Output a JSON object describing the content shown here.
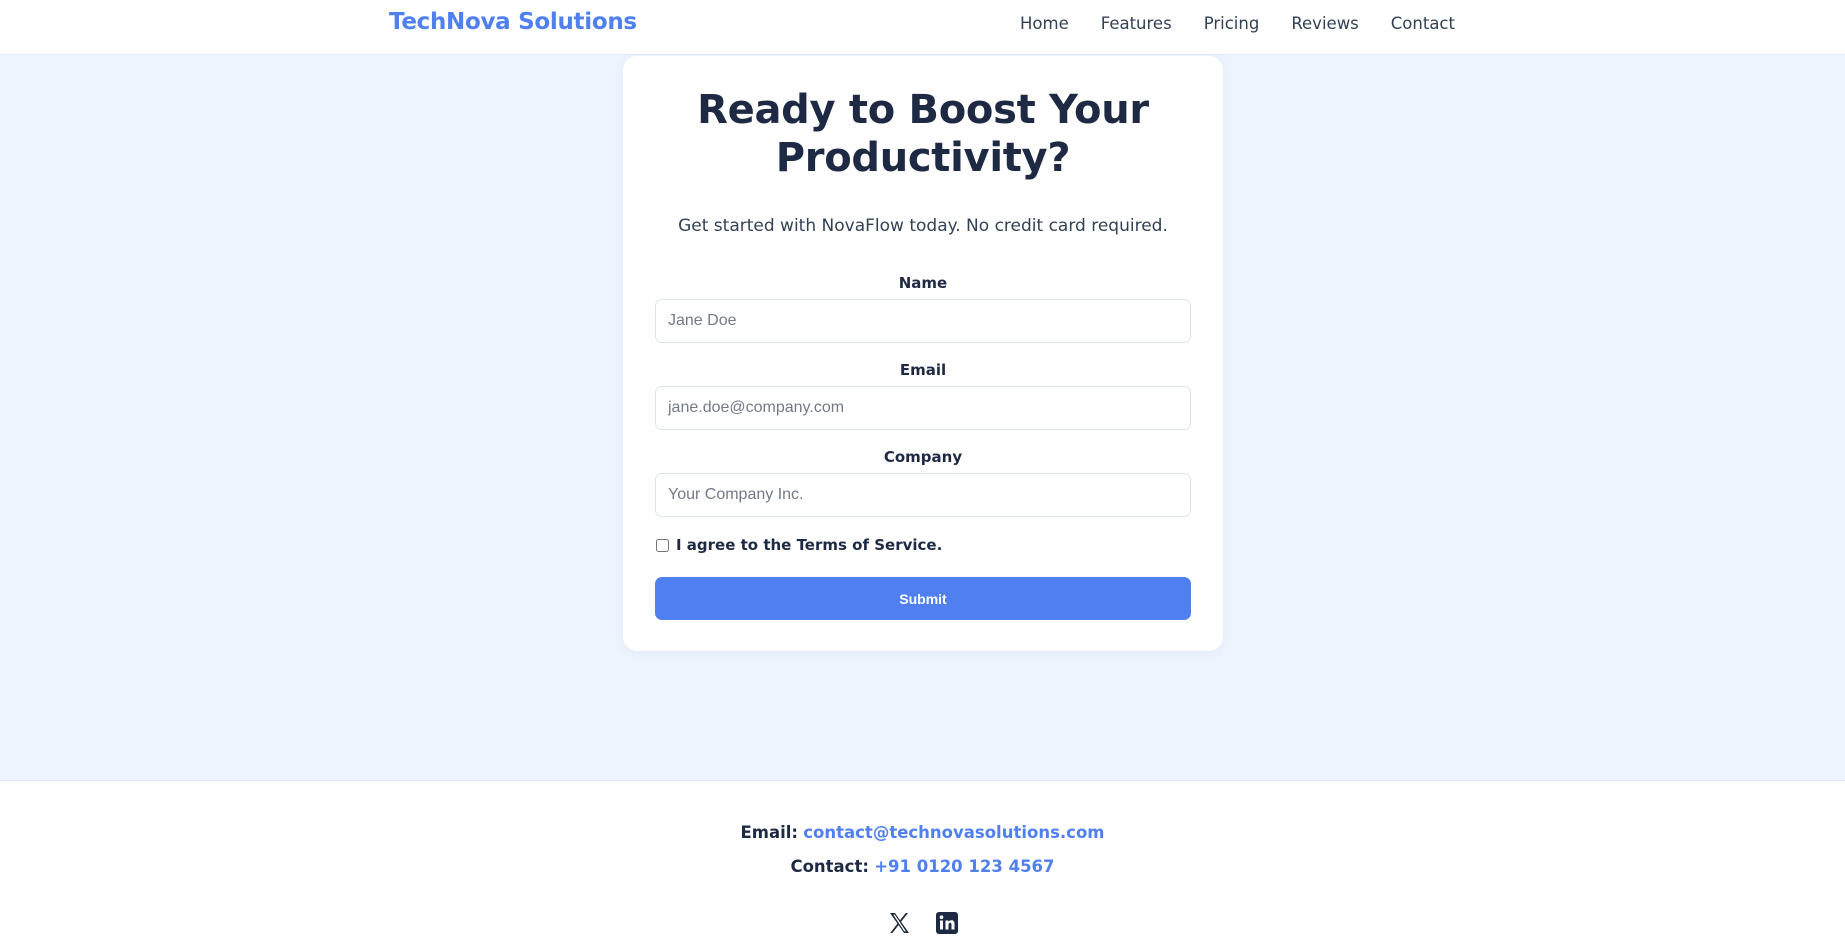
{
  "header": {
    "brand": "TechNova Solutions",
    "nav": [
      "Home",
      "Features",
      "Pricing",
      "Reviews",
      "Contact"
    ]
  },
  "signup": {
    "title": "Ready to Boost Your Productivity?",
    "subtitle": "Get started with NovaFlow today. No credit card required.",
    "name_label": "Name",
    "name_placeholder": "Jane Doe",
    "name_value": "",
    "email_label": "Email",
    "email_placeholder": "jane.doe@company.com",
    "email_value": "",
    "company_label": "Company",
    "company_placeholder": "Your Company Inc.",
    "company_value": "",
    "terms_label": "I agree to the Terms of Service.",
    "terms_checked": false,
    "submit_label": "Submit"
  },
  "footer": {
    "email_key": "Email:",
    "email_value": "contact@technovasolutions.com",
    "contact_key": "Contact:",
    "contact_value": "+91 0120 123 4567",
    "social_icons": [
      "x-icon",
      "linkedin-icon"
    ]
  },
  "colors": {
    "accent": "#5080f0",
    "background": "#eef4fe",
    "text_dark": "#1e2a44"
  }
}
